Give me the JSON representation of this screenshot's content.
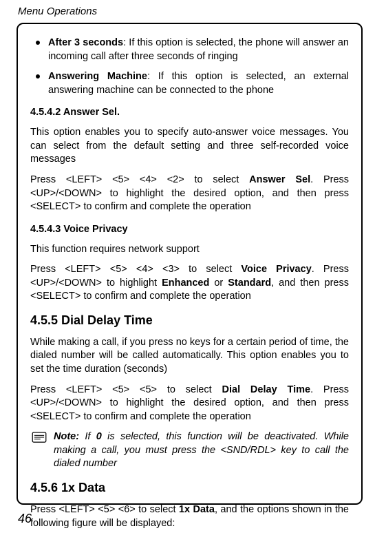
{
  "header": "Menu Operations",
  "bullets": [
    {
      "bold": "After 3 seconds",
      "rest": ": If this option is selected, the phone will answer an incoming call after three seconds of ringing"
    },
    {
      "bold": "Answering Machine",
      "rest": ": If this option is selected, an external answering machine can be connected to the phone"
    }
  ],
  "s1": {
    "head": "4.5.4.2 Answer Sel.",
    "p1": "This option enables you to specify auto-answer voice messages. You can select from the default setting and three self-recorded voice messages",
    "p2a": "Press <LEFT> <5> <4> <2> to select ",
    "p2bold": "Answer Sel",
    "p2b": ". Press <UP>/<DOWN> to highlight the desired option, and then press <SELECT> to confirm and complete the operation"
  },
  "s2": {
    "head": "4.5.4.3 Voice Privacy",
    "p1": "This function requires network support",
    "p2a": "Press <LEFT> <5> <4> <3> to select ",
    "p2bold1": "Voice Privacy",
    "p2b": ". Press <UP>/<DOWN> to highlight ",
    "p2bold2": "Enhanced",
    "p2c": " or ",
    "p2bold3": "Standard",
    "p2d": ", and then press <SELECT> to confirm and complete the operation"
  },
  "s3": {
    "head": "4.5.5 Dial Delay Time",
    "p1": "While making a call, if you press no keys for a certain period of time, the dialed number will be called automatically. This option enables you to set the time duration (seconds)",
    "p2a": "Press <LEFT> <5> <5> to select ",
    "p2bold": "Dial Delay Time",
    "p2b": ". Press <UP>/<DOWN> to highlight the desired option, and then press <SELECT> to confirm and complete the operation"
  },
  "note": {
    "label": "Note:",
    "a": " If ",
    "bold": "0",
    "b": " is selected, this function will be deactivated. While making a call, you must press the <SND/RDL> key to call the dialed number"
  },
  "s4": {
    "head": "4.5.6 1x Data",
    "p1a": "Press <LEFT> <5> <6> to select ",
    "p1bold": "1x Data",
    "p1b": ", and the options shown in the following figure will be displayed:"
  },
  "page_num": "46"
}
